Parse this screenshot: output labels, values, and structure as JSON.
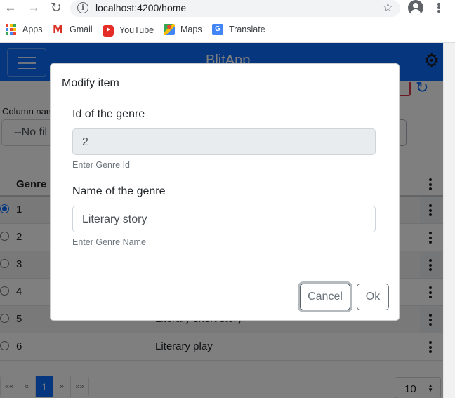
{
  "browser": {
    "url": "localhost:4200/home",
    "bookmarks": [
      {
        "label": "Apps",
        "icon": "apps-grid-icon"
      },
      {
        "label": "Gmail",
        "icon": "gmail-icon"
      },
      {
        "label": "YouTube",
        "icon": "youtube-icon"
      },
      {
        "label": "Maps",
        "icon": "maps-icon"
      },
      {
        "label": "Translate",
        "icon": "translate-icon"
      }
    ]
  },
  "app": {
    "brand": "BlitApp",
    "navbar_color": "#0d6efd",
    "column_label": "Column nam",
    "filter_value": "--No fil",
    "table": {
      "header": "Genre",
      "rows": [
        {
          "id": "1",
          "name": "",
          "selected": true
        },
        {
          "id": "2",
          "name": ""
        },
        {
          "id": "3",
          "name": ""
        },
        {
          "id": "4",
          "name": ""
        },
        {
          "id": "5",
          "name": "Literary short story"
        },
        {
          "id": "6",
          "name": "Literary play"
        }
      ]
    },
    "pagination": {
      "first": "««",
      "prev": "«",
      "current": "1",
      "next": "»",
      "last": "»»"
    },
    "page_size": "10"
  },
  "modal": {
    "title": "Modify item",
    "fields": [
      {
        "label": "Id of the genre",
        "value": "2",
        "help": "Enter Genre Id",
        "readonly": true
      },
      {
        "label": "Name of the genre",
        "value": "Literary story",
        "help": "Enter Genre Name",
        "readonly": false
      }
    ],
    "cancel_label": "Cancel",
    "ok_label": "Ok"
  }
}
